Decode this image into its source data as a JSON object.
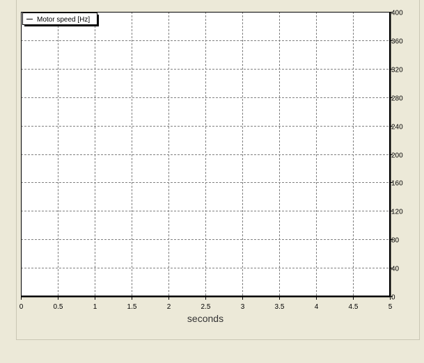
{
  "chart_data": {
    "type": "line",
    "xlabel": "seconds",
    "ylabel": "",
    "xlim": [
      0,
      5
    ],
    "ylim": [
      0,
      400
    ],
    "x_ticks": [
      0,
      0.5,
      1,
      1.5,
      2,
      2.5,
      3,
      3.5,
      4,
      4.5,
      5
    ],
    "x_tick_labels": [
      "0",
      "0.5",
      "1",
      "1.5",
      "2",
      "2.5",
      "3",
      "3.5",
      "4",
      "4.5",
      "5"
    ],
    "y_ticks": [
      0,
      40,
      80,
      120,
      160,
      200,
      240,
      280,
      320,
      360,
      400
    ],
    "y_tick_labels": [
      "0",
      "40",
      "80",
      "120",
      "160",
      "200",
      "240",
      "280",
      "320",
      "360",
      "400"
    ],
    "y_axis_side": "right",
    "grid": true,
    "legend_position": "top-left",
    "series": [
      {
        "name": "Motor speed [Hz]",
        "color": "#000000",
        "x": [],
        "y": []
      }
    ]
  },
  "colors": {
    "window_bg": "#ece9d8",
    "plot_bg": "#ffffff",
    "grid": "#808080",
    "axis": "#000000"
  }
}
